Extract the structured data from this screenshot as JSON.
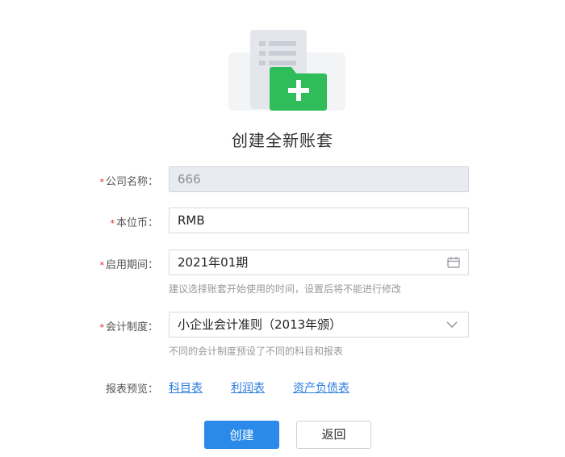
{
  "title": "创建全新账套",
  "fields": {
    "company_name": {
      "label": "公司名称：",
      "value": "666",
      "required": true
    },
    "currency": {
      "label": "本位币：",
      "value": "RMB",
      "required": true
    },
    "start_period": {
      "label": "启用期间：",
      "value": "2021年01期",
      "required": true,
      "hint": "建议选择账套开始使用的时间，设置后将不能进行修改",
      "icon": "calendar-icon"
    },
    "accounting_system": {
      "label": "会计制度：",
      "value": "小企业会计准则（2013年颁）",
      "required": true,
      "hint": "不同的会计制度预设了不同的科目和报表",
      "icon": "chevron-down-icon"
    }
  },
  "report_preview": {
    "label": "报表预览：",
    "links": [
      "科目表",
      "利润表",
      "资产负债表"
    ]
  },
  "buttons": {
    "create": "创建",
    "back": "返回"
  },
  "colors": {
    "primary": "#2b8ae9",
    "link": "#2b7de0",
    "required": "#e02020",
    "folder_green": "#2ebd59",
    "disabled_bg": "#e8ebf0"
  }
}
